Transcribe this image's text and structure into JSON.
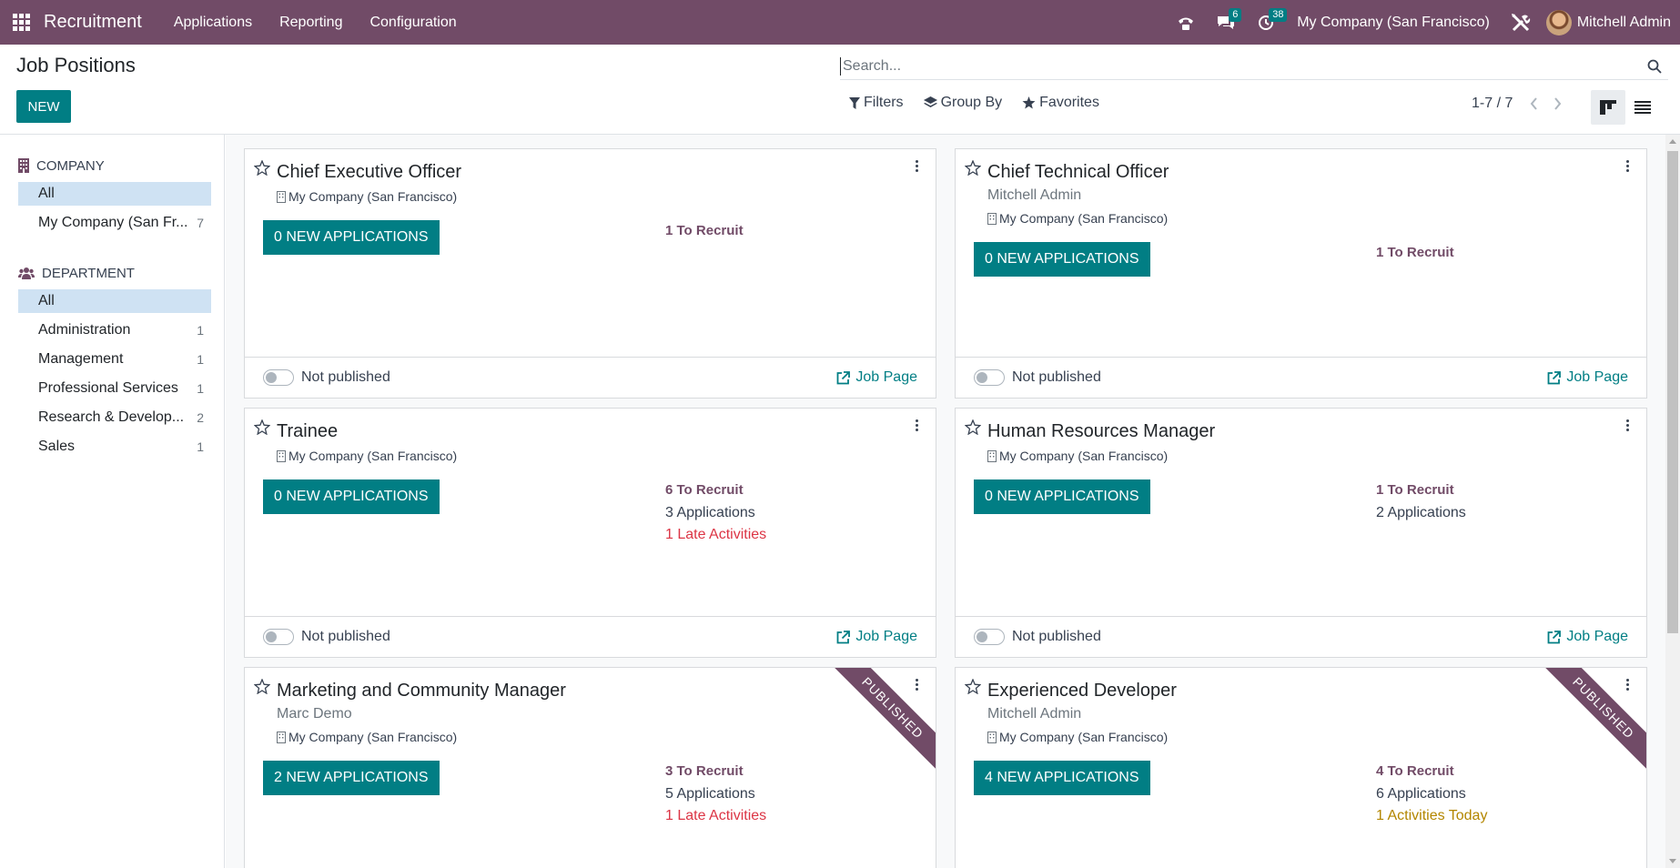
{
  "navbar": {
    "app_name": "Recruitment",
    "menu": [
      "Applications",
      "Reporting",
      "Configuration"
    ],
    "chat_badge": "6",
    "activity_badge": "38",
    "company": "My Company (San Francisco)",
    "user": "Mitchell Admin",
    "icons": [
      "apps-grid-icon",
      "phone-icon",
      "chat-icon",
      "clock-icon",
      "debug-tools-icon"
    ]
  },
  "control_panel": {
    "title": "Job Positions",
    "new_label": "NEW",
    "search_placeholder": "Search...",
    "filters_label": "Filters",
    "group_by_label": "Group By",
    "favorites_label": "Favorites",
    "pager": "1-7 / 7"
  },
  "sidebar": {
    "company_header": "COMPANY",
    "company_items": [
      {
        "label": "All",
        "count": "",
        "active": true
      },
      {
        "label": "My Company (San Fr...",
        "count": "7",
        "active": false
      }
    ],
    "department_header": "DEPARTMENT",
    "department_items": [
      {
        "label": "All",
        "count": "",
        "active": true
      },
      {
        "label": "Administration",
        "count": "1"
      },
      {
        "label": "Management",
        "count": "1"
      },
      {
        "label": "Professional Services",
        "count": "1"
      },
      {
        "label": "Research & Develop...",
        "count": "2"
      },
      {
        "label": "Sales",
        "count": "1"
      }
    ]
  },
  "cards": [
    {
      "title": "Chief Executive Officer",
      "subname": "",
      "company": "My Company (San Francisco)",
      "new_apps": "0 NEW APPLICATIONS",
      "to_recruit": "1 To Recruit",
      "applications": "",
      "activities": "",
      "published_label": "Not published",
      "job_page": "Job Page",
      "ribbon": ""
    },
    {
      "title": "Chief Technical Officer",
      "subname": "Mitchell Admin",
      "company": "My Company (San Francisco)",
      "new_apps": "0 NEW APPLICATIONS",
      "to_recruit": "1 To Recruit",
      "applications": "",
      "activities": "",
      "published_label": "Not published",
      "job_page": "Job Page",
      "ribbon": ""
    },
    {
      "title": "Trainee",
      "subname": "",
      "company": "My Company (San Francisco)",
      "new_apps": "0 NEW APPLICATIONS",
      "to_recruit": "6 To Recruit",
      "applications": "3 Applications",
      "activities": "1 Late Activities",
      "published_label": "Not published",
      "job_page": "Job Page",
      "ribbon": ""
    },
    {
      "title": "Human Resources Manager",
      "subname": "",
      "company": "My Company (San Francisco)",
      "new_apps": "0 NEW APPLICATIONS",
      "to_recruit": "1 To Recruit",
      "applications": "2 Applications",
      "activities": "",
      "published_label": "Not published",
      "job_page": "Job Page",
      "ribbon": ""
    },
    {
      "title": "Marketing and Community Manager",
      "subname": "Marc Demo",
      "company": "My Company (San Francisco)",
      "new_apps": "2 NEW APPLICATIONS",
      "to_recruit": "3 To Recruit",
      "applications": "5 Applications",
      "activities": "1 Late Activities",
      "published_label": "",
      "job_page": "",
      "ribbon": "PUBLISHED"
    },
    {
      "title": "Experienced Developer",
      "subname": "Mitchell Admin",
      "company": "My Company (San Francisco)",
      "new_apps": "4 NEW APPLICATIONS",
      "to_recruit": "4 To Recruit",
      "applications": "6 Applications",
      "activities": "1 Activities Today",
      "published_label": "",
      "job_page": "",
      "ribbon": "PUBLISHED"
    }
  ],
  "colors": {
    "brand": "#714b67",
    "primary": "#017e84",
    "late": "#dc3545",
    "today": "#b38600"
  }
}
